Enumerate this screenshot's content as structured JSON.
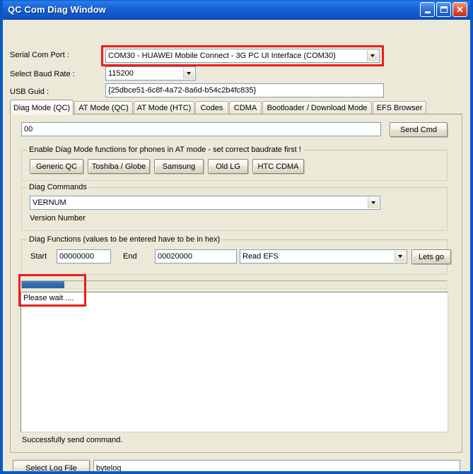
{
  "window": {
    "title": "QC Com Diag Window",
    "caption_buttons": [
      {
        "name": "minimize",
        "label": "_"
      },
      {
        "name": "maximize",
        "label": "□"
      },
      {
        "name": "close",
        "label": "✕"
      }
    ]
  },
  "top_fields": {
    "serial_port_label": "Serial Com Port :",
    "serial_port_value": "COM30 - HUAWEI Mobile Connect - 3G PC UI Interface (COM30)",
    "baud_label": "Select Baud Rate :",
    "baud_value": "115200",
    "usb_guid_label": "USB Guid :",
    "usb_guid_value": "{25dbce51-6c8f-4a72-8a6d-b54c2b4fc835}"
  },
  "tabs": [
    {
      "label": "Diag Mode (QC)",
      "active": true
    },
    {
      "label": "AT Mode (QC)",
      "active": false
    },
    {
      "label": "AT Mode (HTC)",
      "active": false
    },
    {
      "label": "Codes",
      "active": false
    },
    {
      "label": "CDMA",
      "active": false
    },
    {
      "label": "Bootloader / Download Mode",
      "active": false
    },
    {
      "label": "EFS Browser",
      "active": false
    }
  ],
  "diag_tab": {
    "command_value": "00",
    "send_cmd_label": "Send Cmd",
    "enable_group_title": "Enable Diag Mode functions for phones in AT mode - set correct baudrate first !",
    "enable_buttons": [
      {
        "label": "Generic QC"
      },
      {
        "label": "Toshiba / Globe"
      },
      {
        "label": "Samsung"
      },
      {
        "label": "Old LG"
      },
      {
        "label": "HTC CDMA"
      }
    ],
    "diag_commands_group_title": "Diag Commands",
    "diag_command_value": "VERNUM",
    "diag_command_description": "Version Number",
    "diag_functions_group_title": "Diag Functions (values to be entered have to be in hex)",
    "start_label": "Start",
    "start_value": "00000000",
    "end_label": "End",
    "end_value": "00020000",
    "function_value": "Read EFS",
    "lets_go_label": "Lets go",
    "progress_percent": 10,
    "log_text": "Please wait ....",
    "status_text": "Successfully send command."
  },
  "footer": {
    "select_log_file_label": "Select Log File",
    "log_file_value": "bytelog"
  },
  "colors": {
    "title_bar_blue": "#0A58C8",
    "window_face": "#ECE9D8",
    "annotation_red": "#EE1C18",
    "progress_blue": "#2E6DB4",
    "close_button_red": "#C42E14"
  }
}
